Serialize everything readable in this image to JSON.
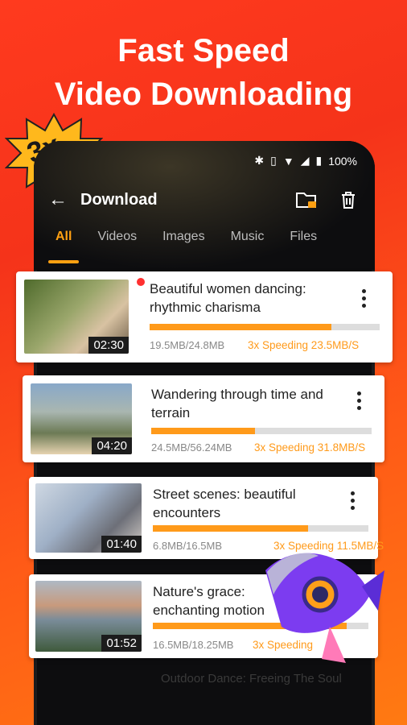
{
  "headline": {
    "line1": "Fast Speed",
    "line2": "Video Downloading"
  },
  "badge": {
    "text": "3x"
  },
  "status": {
    "battery": "100%"
  },
  "appbar": {
    "title": "Download"
  },
  "tabs": [
    "All",
    "Videos",
    "Images",
    "Music",
    "Files"
  ],
  "downloads": [
    {
      "title": "Beautiful women dancing: rhythmic charisma",
      "duration": "02:30",
      "size": "19.5MB/24.8MB",
      "speed": "3x Speeding 23.5MB/S",
      "progress": 0.79
    },
    {
      "title": "Wandering through time and terrain",
      "duration": "04:20",
      "size": "24.5MB/56.24MB",
      "speed": "3x Speeding 31.8MB/S",
      "progress": 0.47
    },
    {
      "title": "Street scenes: beautiful encounters",
      "duration": "01:40",
      "size": "6.8MB/16.5MB",
      "speed": "3x Speeding 11.5MB/S",
      "progress": 0.72
    },
    {
      "title": "Nature's grace: enchanting motion",
      "duration": "01:52",
      "size": "16.5MB/18.25MB",
      "speed": "3x Speeding",
      "progress": 0.9
    }
  ],
  "ghost_item": {
    "title": "Outdoor Dance: Freeing The Soul"
  },
  "colors": {
    "accent": "#ff9a1a",
    "background": "#ff3a1e"
  }
}
